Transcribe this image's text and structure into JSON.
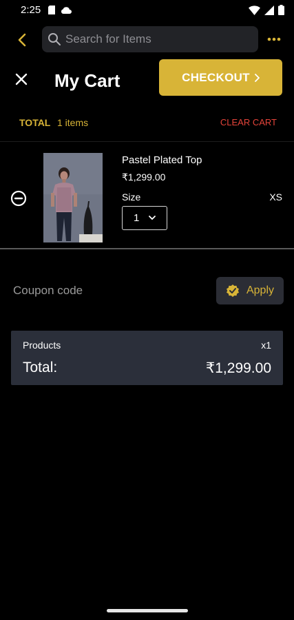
{
  "status_bar": {
    "time": "2:25",
    "left_icons": [
      "sim-card-icon",
      "cloud-icon"
    ],
    "right_icons": [
      "wifi-icon",
      "signal-icon",
      "battery-icon"
    ]
  },
  "top_bar": {
    "search_placeholder": "Search for Items",
    "back_icon": "chevron-left-icon",
    "more_icon": "more-dots-icon"
  },
  "cart": {
    "title": "My Cart",
    "checkout_label": "CHECKOUT",
    "total_label": "TOTAL",
    "items_count": "1 items",
    "clear_label": "CLEAR CART"
  },
  "items": [
    {
      "name": "Pastel Plated Top",
      "price": "₹1,299.00",
      "size_label": "Size",
      "size_value": "XS",
      "quantity": "1"
    }
  ],
  "coupon": {
    "label": "Coupon code",
    "apply_label": "Apply"
  },
  "summary": {
    "products_label": "Products",
    "products_count": "x1",
    "total_label": "Total:",
    "total_value": "₹1,299.00"
  },
  "colors": {
    "accent": "#d8b437",
    "danger": "#e5443a",
    "background": "#000000",
    "card": "#2b2f3a"
  }
}
